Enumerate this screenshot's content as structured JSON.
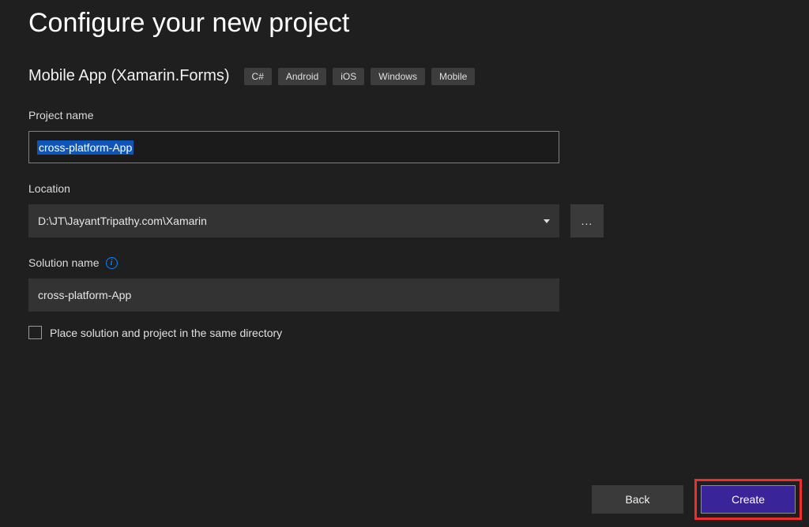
{
  "page_title": "Configure your new project",
  "template": "Mobile App (Xamarin.Forms)",
  "tags": [
    "C#",
    "Android",
    "iOS",
    "Windows",
    "Mobile"
  ],
  "fields": {
    "project_name": {
      "label": "Project name",
      "value": "cross-platform-App"
    },
    "location": {
      "label": "Location",
      "value": "D:\\JT\\JayantTripathy.com\\Xamarin",
      "browse_label": "..."
    },
    "solution_name": {
      "label": "Solution name",
      "value": "cross-platform-App",
      "info_tooltip": "i"
    }
  },
  "same_dir_checkbox": {
    "label": "Place solution and project in the same directory",
    "checked": false
  },
  "buttons": {
    "back": "Back",
    "create": "Create"
  }
}
